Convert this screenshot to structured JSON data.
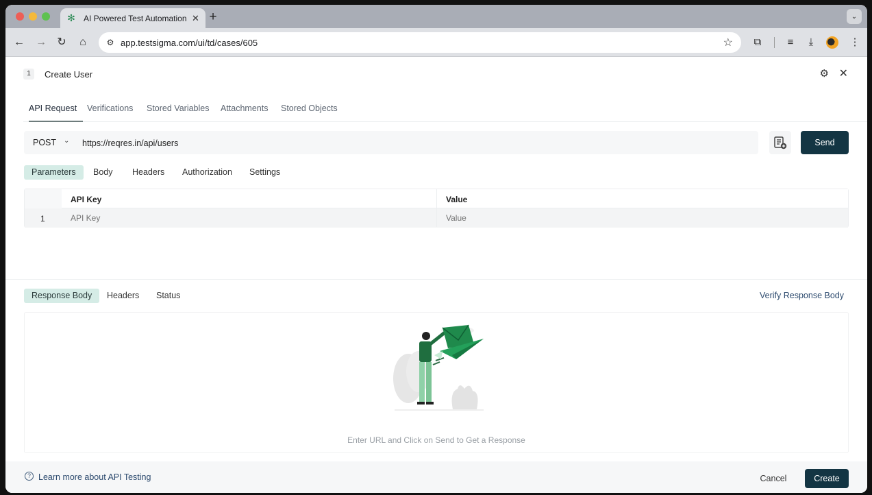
{
  "browser": {
    "tab_title": "AI Powered Test Automation P",
    "url": "app.testsigma.com/ui/td/cases/605",
    "icons": {
      "back": "arrow-left-icon",
      "forward": "arrow-right-icon",
      "reload": "reload-icon",
      "home": "home-icon",
      "site_settings": "tune-icon",
      "bookmark": "star-icon",
      "extensions": "puzzle-icon",
      "media": "playlist-icon",
      "downloads": "download-icon",
      "menu": "kebab-icon"
    }
  },
  "header": {
    "step_number": "1",
    "title": "Create User"
  },
  "main_tabs": [
    {
      "label": "API Request",
      "active": true
    },
    {
      "label": "Verifications",
      "active": false
    },
    {
      "label": "Stored Variables",
      "active": false
    },
    {
      "label": "Attachments",
      "active": false
    },
    {
      "label": "Stored Objects",
      "active": false
    }
  ],
  "request": {
    "method": "POST",
    "url": "https://reqres.in/api/users",
    "send_label": "Send"
  },
  "request_tabs": [
    {
      "label": "Parameters",
      "active": true
    },
    {
      "label": "Body",
      "active": false
    },
    {
      "label": "Headers",
      "active": false
    },
    {
      "label": "Authorization",
      "active": false
    },
    {
      "label": "Settings",
      "active": false
    }
  ],
  "params_table": {
    "columns": [
      "API Key",
      "Value"
    ],
    "rows": [
      {
        "index": "1",
        "key_placeholder": "API Key",
        "value_placeholder": "Value"
      }
    ]
  },
  "response_tabs": [
    {
      "label": "Response Body",
      "active": true
    },
    {
      "label": "Headers",
      "active": false
    },
    {
      "label": "Status",
      "active": false
    }
  ],
  "response": {
    "verify_link": "Verify Response Body",
    "empty_message": "Enter URL and Click on Send to Get a Response"
  },
  "footer": {
    "help_link": "Learn more about API Testing",
    "cancel_label": "Cancel",
    "create_label": "Create"
  },
  "colors": {
    "primary_button": "#133543",
    "active_tab_bg": "#d5ece6",
    "link": "#2c4a6e",
    "illustration_green": "#1f8a4c"
  }
}
